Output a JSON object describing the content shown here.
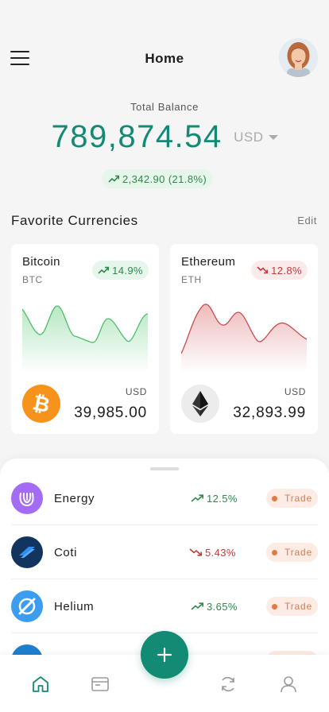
{
  "header": {
    "title": "Home",
    "menu_icon": "hamburger-menu-icon",
    "avatar_icon": "user-avatar-icon"
  },
  "balance": {
    "label": "Total Balance",
    "value": "789,874.54",
    "currency": "USD",
    "change": "2,342.90 (21.8%)",
    "change_direction": "up"
  },
  "favorites": {
    "title": "Favorite Currencies",
    "edit_label": "Edit",
    "cards": [
      {
        "name": "Bitcoin",
        "symbol": "BTC",
        "change": "14.9%",
        "direction": "up",
        "currency": "USD",
        "price": "39,985.00",
        "icon": "bitcoin-icon",
        "color": "#f7931a"
      },
      {
        "name": "Ethereum",
        "symbol": "ETH",
        "change": "12.8%",
        "direction": "down",
        "currency": "USD",
        "price": "32,893.99",
        "icon": "ethereum-icon",
        "color": "#3c3c3d"
      }
    ]
  },
  "coins": [
    {
      "name": "Energy",
      "change": "12.5%",
      "direction": "up",
      "action": "Trade",
      "icon": "energy-icon",
      "color": "#a46bf5"
    },
    {
      "name": "Coti",
      "change": "5.43%",
      "direction": "down",
      "action": "Trade",
      "icon": "coti-icon",
      "color": "#1a3d6b"
    },
    {
      "name": "Helium",
      "change": "3.65%",
      "direction": "up",
      "action": "Trade",
      "icon": "helium-icon",
      "color": "#3b9cf0"
    }
  ],
  "colors": {
    "accent": "#128a74",
    "up": "#2d8a4a",
    "down": "#c33a3a",
    "trade": "#e07a4a"
  },
  "nav": {
    "items": [
      "home-icon",
      "wallet-icon",
      "add-icon",
      "exchange-icon",
      "profile-icon"
    ]
  }
}
